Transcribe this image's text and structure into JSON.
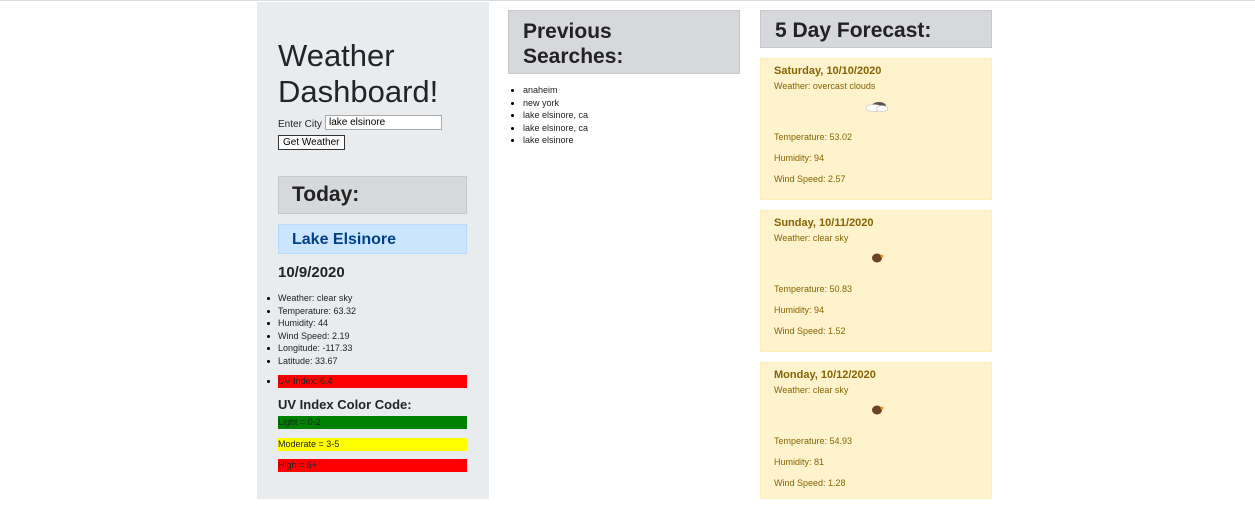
{
  "app": {
    "title": "Weather Dashboard!"
  },
  "search": {
    "label": "Enter City",
    "value": "lake elsinore",
    "button": "Get Weather"
  },
  "today": {
    "heading": "Today:",
    "city": "Lake Elsinore",
    "date": "10/9/2020",
    "details": [
      "Weather: clear sky",
      "Temperature: 63.32",
      "Humidity: 44",
      "Wind Speed: 2.19",
      "Longitude: -117.33",
      "Latitude: 33.67"
    ],
    "uv_index": "UV Index: 6.4",
    "uv_color": "#ff0000"
  },
  "uv_legend": {
    "heading": "UV Index Color Code:",
    "items": [
      {
        "label": "Light = 0-2",
        "color": "#008000"
      },
      {
        "label": "Moderate = 3-5",
        "color": "#ffff00"
      },
      {
        "label": "High = 6+",
        "color": "#ff0000"
      }
    ]
  },
  "previous": {
    "heading": "Previous Searches:",
    "items": [
      "anaheim",
      "new york",
      "lake elsinore, ca",
      "lake elsinore, ca",
      "lake elsinore"
    ]
  },
  "forecast": {
    "heading": "5 Day Forecast:",
    "days": [
      {
        "date": "Saturday, 10/10/2020",
        "weather": "Weather: overcast clouds",
        "icon": "overcast-clouds-icon",
        "temperature": "Temperature: 53.02",
        "humidity": "Humidity: 94",
        "wind": "Wind Speed: 2.57"
      },
      {
        "date": "Sunday, 10/11/2020",
        "weather": "Weather: clear sky",
        "icon": "clear-sky-icon",
        "temperature": "Temperature: 50.83",
        "humidity": "Humidity: 94",
        "wind": "Wind Speed: 1.52"
      },
      {
        "date": "Monday, 10/12/2020",
        "weather": "Weather: clear sky",
        "icon": "clear-sky-icon",
        "temperature": "Temperature: 54.93",
        "humidity": "Humidity: 81",
        "wind": "Wind Speed: 1.28"
      }
    ]
  },
  "colors": {
    "panel_bg": "#e9ecef",
    "header_bg": "#d6d8db",
    "city_bg": "#cce5ff",
    "card_bg": "#fff3cd",
    "card_text": "#856404"
  }
}
